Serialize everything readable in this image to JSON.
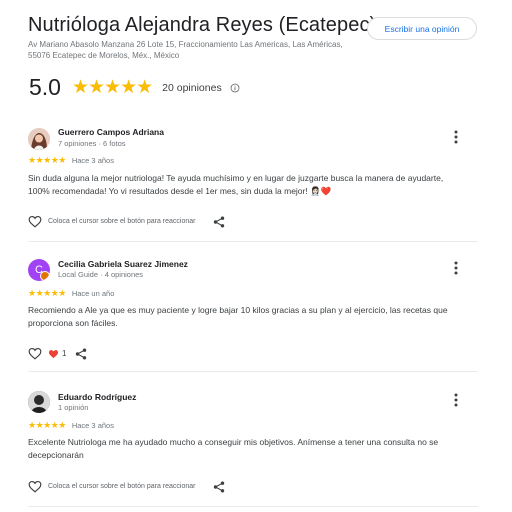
{
  "place": {
    "title": "Nutrióloga Alejandra Reyes (Ecatepec)",
    "address": "Av Mariano Abasolo Manzana 26 Lote 15, Fraccionamiento Las Americas, Las Américas, 55076 Ecatepec de Morelos, Méx., México",
    "write_review_label": "Escribir una opinión"
  },
  "summary": {
    "rating": "5.0",
    "stars": "★★★★★",
    "count_label": "20 opiniones",
    "info_icon": "info-icon"
  },
  "reviews": [
    {
      "name": "Guerrero Campos Adriana",
      "meta": "7 opiniones · 6 fotos",
      "stars": "★★★★★",
      "date": "Hace 3 años",
      "text": "Sin duda alguna la mejor nutriologa! Te ayuda muchísimo y en lugar de juzgarte busca la manera de ayudarte, 100% recomendada! Yo vi resultados desde el 1er mes, sin duda la mejor! 👩🏻‍⚕️❤️",
      "react_hint": "Coloca el cursor sobre el botón para reaccionar",
      "avatar_color": "#c98a7a"
    },
    {
      "name": "Cecilia Gabriela Suarez Jimenez",
      "meta": "Local Guide · 4 opiniones",
      "stars": "★★★★★",
      "date": "Hace un año",
      "text": "Recomiendo a Ale ya que es muy paciente y logre bajar 10 kilos gracias a su plan y al ejercicio, las recetas que proporciona son fáciles.",
      "reaction_count": "1",
      "avatar_letter": "C",
      "avatar_color": "#a142f4"
    },
    {
      "name": "Eduardo Rodríguez",
      "meta": "1 opinión",
      "stars": "★★★★★",
      "date": "Hace 3 años",
      "text": "Excelente Nutriologa me ha ayudado mucho a conseguir mis objetivos. Anímense a tener una consulta no se decepcionarán",
      "react_hint": "Coloca el cursor sobre el botón para reaccionar",
      "avatar_color": "#3c4043"
    }
  ],
  "colors": {
    "star": "#fbbc04",
    "link": "#1a73e8",
    "reaction_heart": "#ea4335"
  }
}
